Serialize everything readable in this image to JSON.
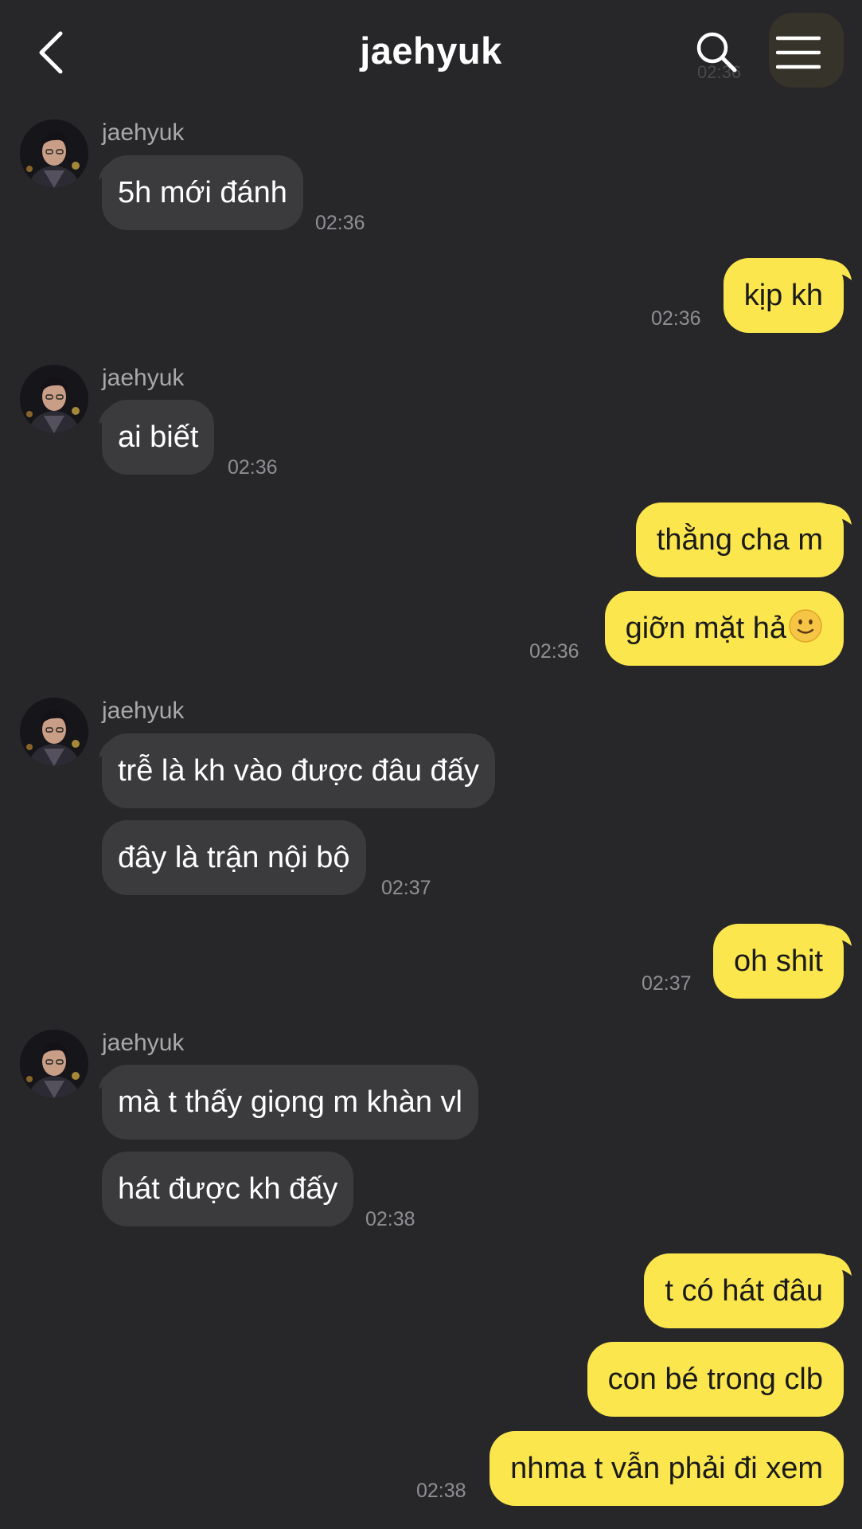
{
  "header": {
    "title": "jaehyuk",
    "back_icon": "chevron-left-icon",
    "search_icon": "search-icon",
    "menu_icon": "hamburger-menu-icon",
    "ghost_time": "02:36"
  },
  "colors": {
    "background": "#27272a",
    "incoming_bubble": "#3b3b3e",
    "outgoing_bubble": "#fbe64d",
    "timestamp": "#8f8f93",
    "sender_name": "#a8a8ab"
  },
  "messages": {
    "g1": {
      "sender": "jaehyuk",
      "m1": "5h mới đánh",
      "time": "02:36"
    },
    "o1": {
      "m1": "kịp kh",
      "time": "02:36"
    },
    "g2": {
      "sender": "jaehyuk",
      "m1": "ai biết",
      "time": "02:36"
    },
    "o2": {
      "m1": "thằng cha m",
      "m2": "giỡn mặt hả",
      "emoji": "slightly-smiling-face",
      "time": "02:36"
    },
    "g3": {
      "sender": "jaehyuk",
      "m1": "trễ là kh vào được đâu đấy",
      "m2": "đây là trận nội bộ",
      "time": "02:37"
    },
    "o3": {
      "m1": "oh shit",
      "time": "02:37"
    },
    "g4": {
      "sender": "jaehyuk",
      "m1": "mà t thấy giọng m khàn vl",
      "m2": "hát được kh đấy",
      "time": "02:38"
    },
    "o4": {
      "m1": "t có hát đâu",
      "m2": "con bé trong clb",
      "m3": "nhma t vẫn phải đi xem",
      "time": "02:38"
    }
  }
}
